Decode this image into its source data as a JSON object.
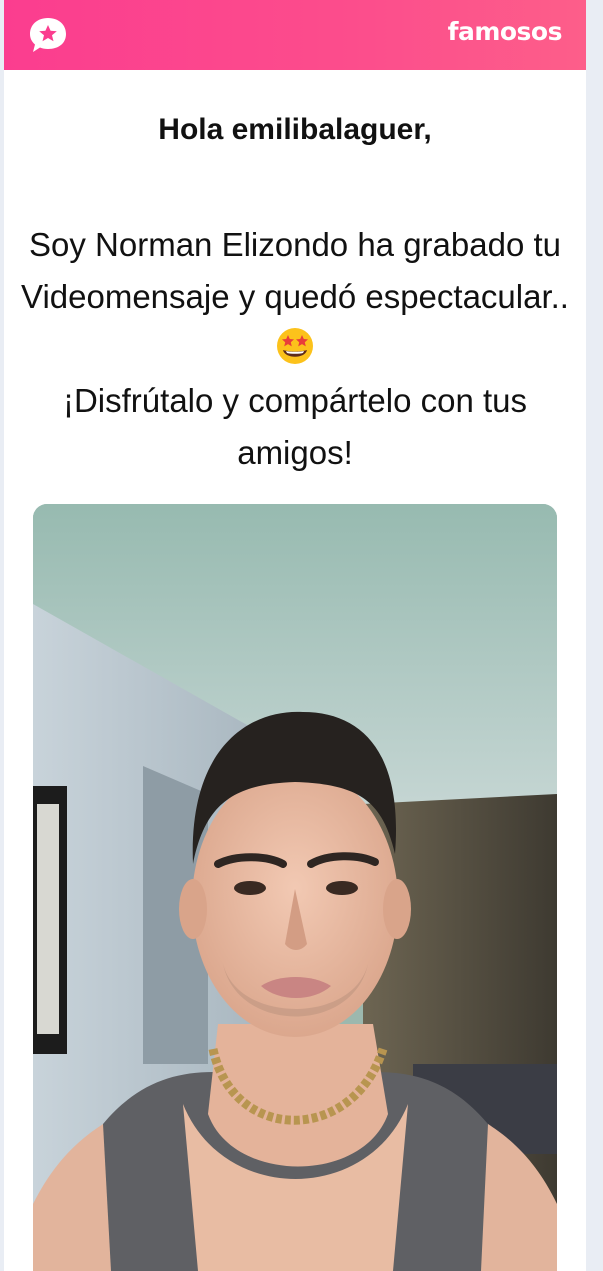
{
  "header": {
    "brand": "famosos",
    "logo_icon": "chat-bubble-star-icon",
    "gradient": [
      "#fb3d8f",
      "#fd5e8a"
    ]
  },
  "greeting": "Hola emilibalaguer,",
  "message": {
    "line1": "Soy Norman Elizondo ha grabado tu Videomensaje y quedó espectacular..",
    "emoji": "star-struck-emoji-icon",
    "line2": "¡Disfrútalo y compártelo con tus amigos!"
  },
  "video": {
    "subject": "video-thumbnail-image"
  }
}
